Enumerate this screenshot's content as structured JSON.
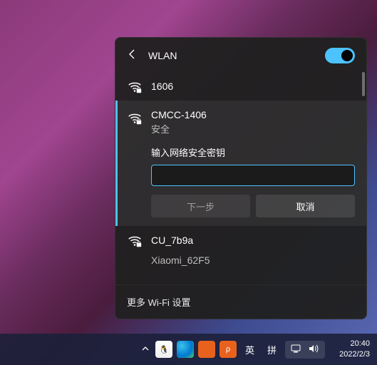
{
  "flyout": {
    "title": "WLAN",
    "wifi_enabled": true,
    "networks": {
      "n0": {
        "name": "1606"
      },
      "selected": {
        "name": "CMCC-1406",
        "security": "安全",
        "prompt": "输入网络安全密钥",
        "next": "下一步",
        "cancel": "取消"
      },
      "n2": {
        "name": "CU_7b9a"
      },
      "n3": {
        "name": "Xiaomi_62F5"
      }
    },
    "more": "更多 Wi-Fi 设置"
  },
  "taskbar": {
    "ime1": "英",
    "ime2": "拼",
    "time": "20:40",
    "date": "2022/2/3"
  }
}
